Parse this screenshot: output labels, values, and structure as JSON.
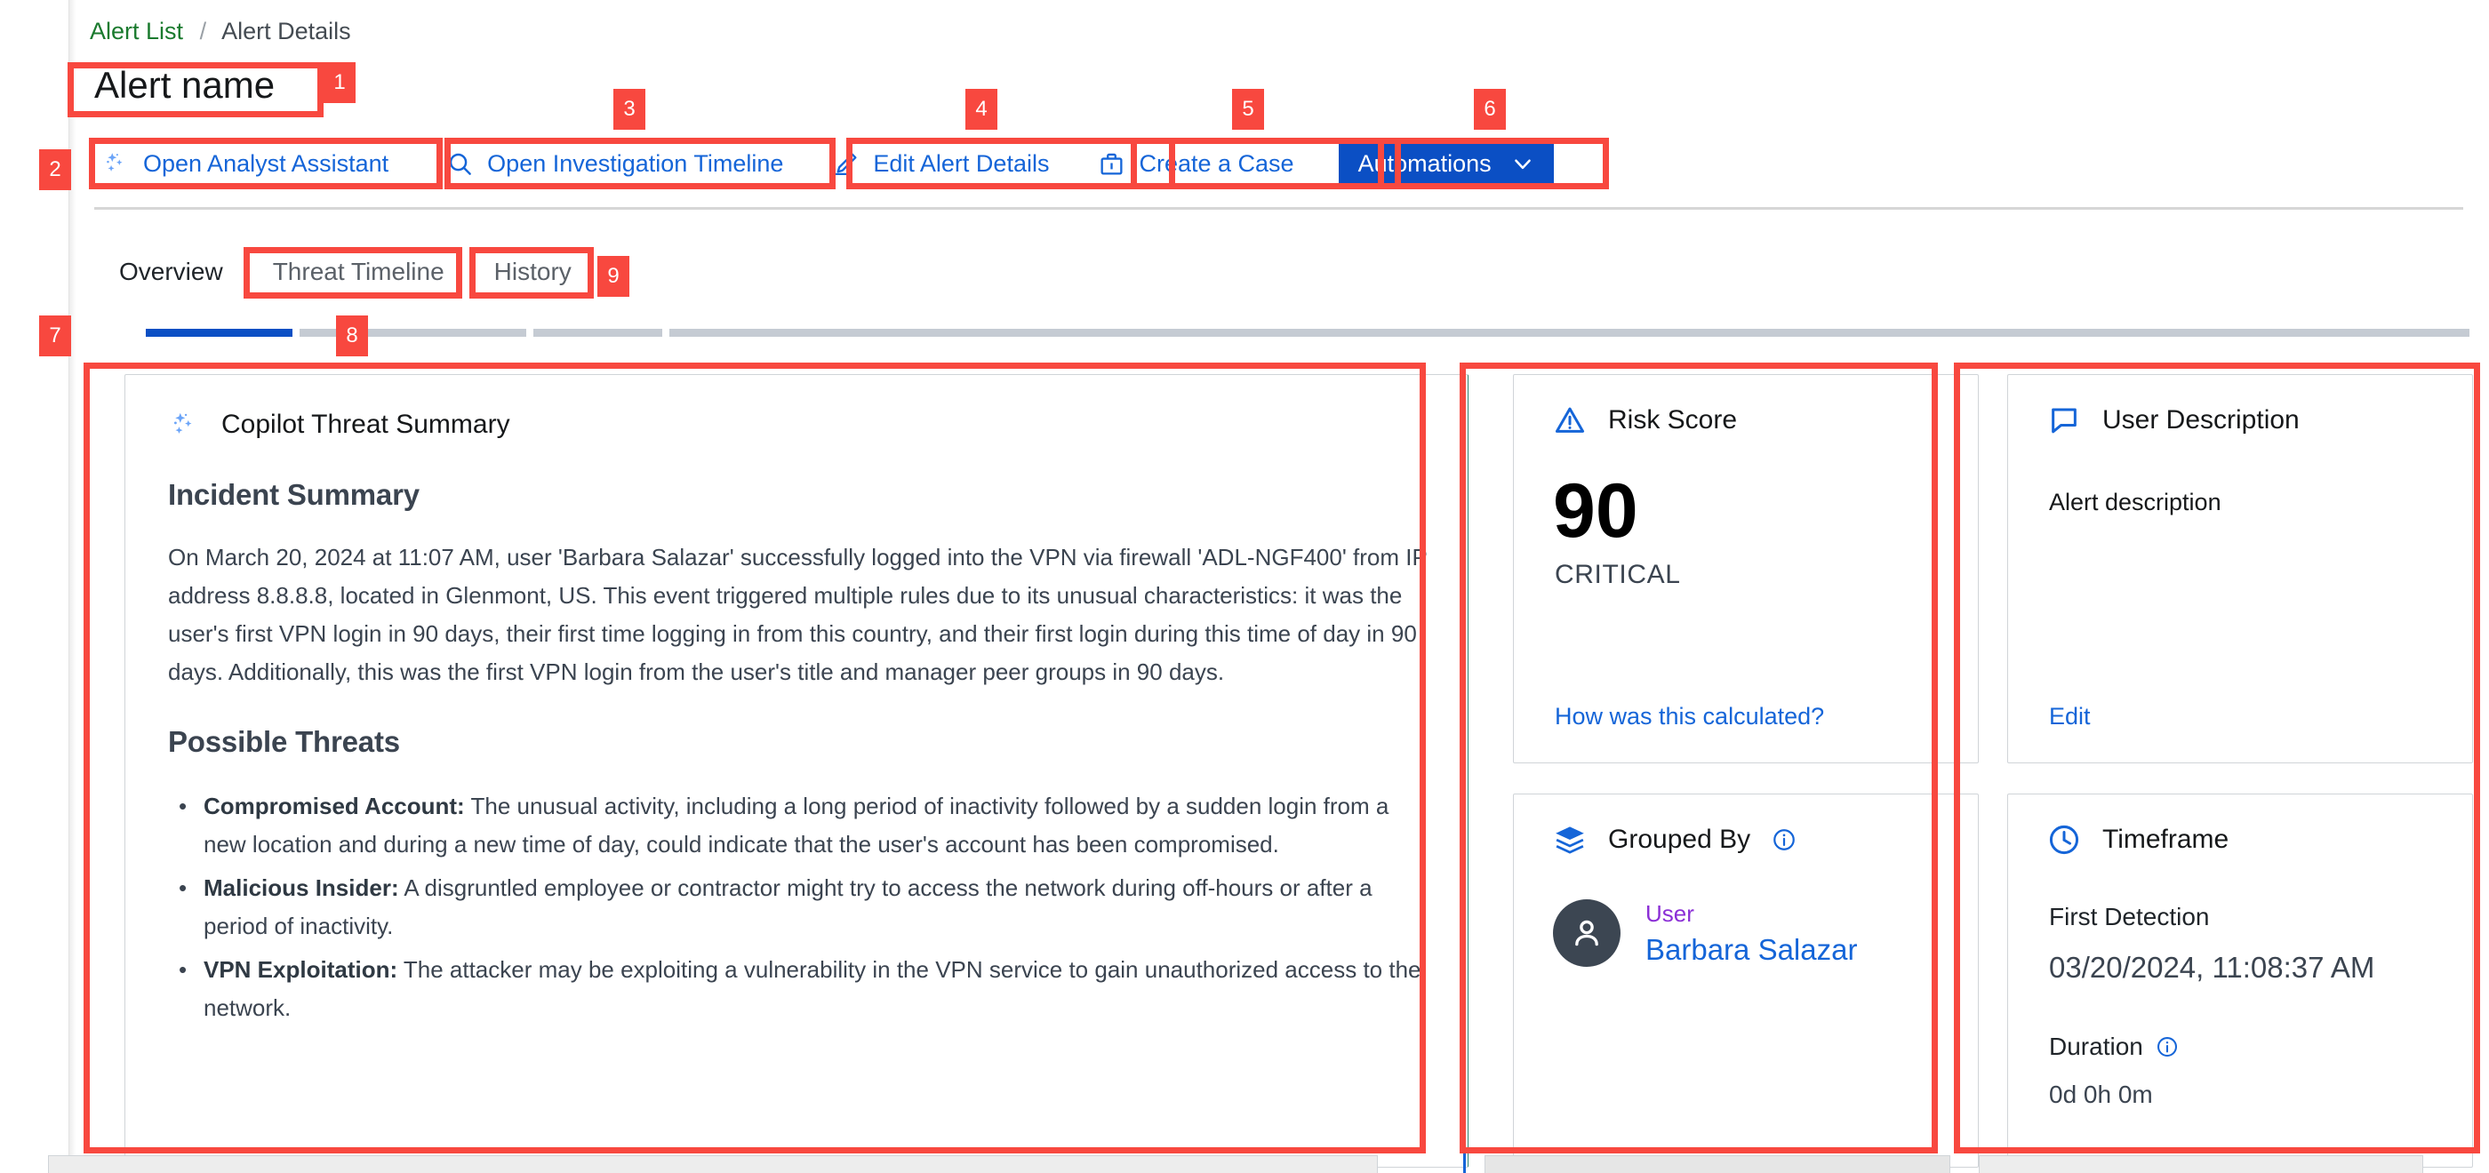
{
  "breadcrumb": {
    "link": "Alert List",
    "separator": "/",
    "current": "Alert Details"
  },
  "page": {
    "title": "Alert name"
  },
  "toolbar": {
    "analyst_assistant": "Open Analyst Assistant",
    "investigation_timeline": "Open Investigation Timeline",
    "edit_alert": "Edit Alert Details",
    "create_case": "Create a Case",
    "automations": "Automations"
  },
  "tabs": [
    {
      "label": "Overview",
      "active": true
    },
    {
      "label": "Threat Timeline",
      "active": false
    },
    {
      "label": "History",
      "active": false
    }
  ],
  "summary": {
    "panel_title": "Copilot Threat Summary",
    "incident_heading": "Incident Summary",
    "incident_text": "On March 20, 2024 at 11:07 AM, user 'Barbara Salazar' successfully logged into the VPN via firewall 'ADL-NGF400' from IP address 8.8.8.8, located in Glenmont, US. This event triggered multiple rules due to its unusual characteristics: it was the user's first VPN login in 90 days, their first time logging in from this country, and their first login during this time of day in 90 days. Additionally, this was the first VPN login from the user's title and manager peer groups in 90 days.",
    "threats_heading": "Possible Threats",
    "threats": [
      {
        "name": "Compromised Account:",
        "text": " The unusual activity, including a long period of inactivity followed by a sudden login from a new location and during a new time of day, could indicate that the user's account has been compromised."
      },
      {
        "name": "Malicious Insider:",
        "text": " A disgruntled employee or contractor might try to access the network during off-hours or after a period of inactivity."
      },
      {
        "name": "VPN Exploitation:",
        "text": " The attacker may be exploiting a vulnerability in the VPN service to gain unauthorized access to the network."
      }
    ]
  },
  "risk_score": {
    "title": "Risk Score",
    "value": "90",
    "severity": "CRITICAL",
    "link": "How was this calculated?"
  },
  "user_description": {
    "title": "User Description",
    "text": "Alert description",
    "edit_link": "Edit"
  },
  "grouped_by": {
    "title": "Grouped By",
    "entity_type": "User",
    "entity_name": "Barbara Salazar"
  },
  "timeframe": {
    "title": "Timeframe",
    "first_detection_label": "First Detection",
    "first_detection_value": "03/20/2024, 11:08:37 AM",
    "duration_label": "Duration",
    "duration_value": "0d 0h 0m"
  },
  "annotations": [
    {
      "id": "1"
    },
    {
      "id": "2"
    },
    {
      "id": "3"
    },
    {
      "id": "4"
    },
    {
      "id": "5"
    },
    {
      "id": "6"
    },
    {
      "id": "7"
    },
    {
      "id": "8"
    },
    {
      "id": "9"
    }
  ],
  "colors": {
    "accent_blue": "#1565d8",
    "primary_button": "#0b4fc4",
    "annotation_red": "#f8483f",
    "breadcrumb_link_green": "#1a7a2e",
    "entity_purple": "#8b2fd6",
    "avatar_bg": "#3c4652"
  }
}
